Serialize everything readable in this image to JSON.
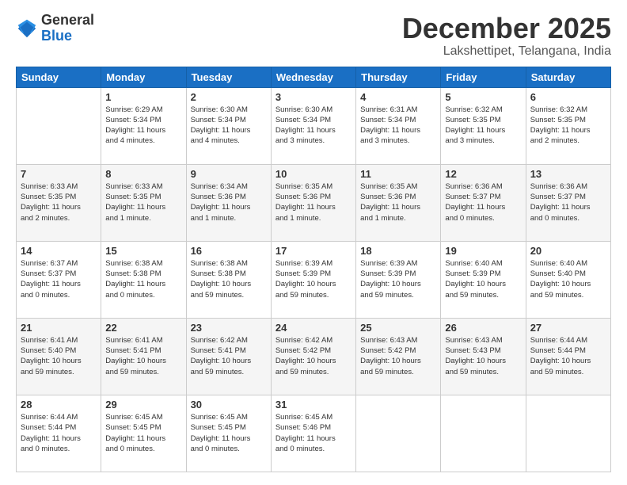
{
  "logo": {
    "general": "General",
    "blue": "Blue"
  },
  "title": "December 2025",
  "location": "Lakshettipet, Telangana, India",
  "weekdays": [
    "Sunday",
    "Monday",
    "Tuesday",
    "Wednesday",
    "Thursday",
    "Friday",
    "Saturday"
  ],
  "weeks": [
    [
      {
        "day": "",
        "info": ""
      },
      {
        "day": "1",
        "info": "Sunrise: 6:29 AM\nSunset: 5:34 PM\nDaylight: 11 hours\nand 4 minutes."
      },
      {
        "day": "2",
        "info": "Sunrise: 6:30 AM\nSunset: 5:34 PM\nDaylight: 11 hours\nand 4 minutes."
      },
      {
        "day": "3",
        "info": "Sunrise: 6:30 AM\nSunset: 5:34 PM\nDaylight: 11 hours\nand 3 minutes."
      },
      {
        "day": "4",
        "info": "Sunrise: 6:31 AM\nSunset: 5:34 PM\nDaylight: 11 hours\nand 3 minutes."
      },
      {
        "day": "5",
        "info": "Sunrise: 6:32 AM\nSunset: 5:35 PM\nDaylight: 11 hours\nand 3 minutes."
      },
      {
        "day": "6",
        "info": "Sunrise: 6:32 AM\nSunset: 5:35 PM\nDaylight: 11 hours\nand 2 minutes."
      }
    ],
    [
      {
        "day": "7",
        "info": "Sunrise: 6:33 AM\nSunset: 5:35 PM\nDaylight: 11 hours\nand 2 minutes."
      },
      {
        "day": "8",
        "info": "Sunrise: 6:33 AM\nSunset: 5:35 PM\nDaylight: 11 hours\nand 1 minute."
      },
      {
        "day": "9",
        "info": "Sunrise: 6:34 AM\nSunset: 5:36 PM\nDaylight: 11 hours\nand 1 minute."
      },
      {
        "day": "10",
        "info": "Sunrise: 6:35 AM\nSunset: 5:36 PM\nDaylight: 11 hours\nand 1 minute."
      },
      {
        "day": "11",
        "info": "Sunrise: 6:35 AM\nSunset: 5:36 PM\nDaylight: 11 hours\nand 1 minute."
      },
      {
        "day": "12",
        "info": "Sunrise: 6:36 AM\nSunset: 5:37 PM\nDaylight: 11 hours\nand 0 minutes."
      },
      {
        "day": "13",
        "info": "Sunrise: 6:36 AM\nSunset: 5:37 PM\nDaylight: 11 hours\nand 0 minutes."
      }
    ],
    [
      {
        "day": "14",
        "info": "Sunrise: 6:37 AM\nSunset: 5:37 PM\nDaylight: 11 hours\nand 0 minutes."
      },
      {
        "day": "15",
        "info": "Sunrise: 6:38 AM\nSunset: 5:38 PM\nDaylight: 11 hours\nand 0 minutes."
      },
      {
        "day": "16",
        "info": "Sunrise: 6:38 AM\nSunset: 5:38 PM\nDaylight: 10 hours\nand 59 minutes."
      },
      {
        "day": "17",
        "info": "Sunrise: 6:39 AM\nSunset: 5:39 PM\nDaylight: 10 hours\nand 59 minutes."
      },
      {
        "day": "18",
        "info": "Sunrise: 6:39 AM\nSunset: 5:39 PM\nDaylight: 10 hours\nand 59 minutes."
      },
      {
        "day": "19",
        "info": "Sunrise: 6:40 AM\nSunset: 5:39 PM\nDaylight: 10 hours\nand 59 minutes."
      },
      {
        "day": "20",
        "info": "Sunrise: 6:40 AM\nSunset: 5:40 PM\nDaylight: 10 hours\nand 59 minutes."
      }
    ],
    [
      {
        "day": "21",
        "info": "Sunrise: 6:41 AM\nSunset: 5:40 PM\nDaylight: 10 hours\nand 59 minutes."
      },
      {
        "day": "22",
        "info": "Sunrise: 6:41 AM\nSunset: 5:41 PM\nDaylight: 10 hours\nand 59 minutes."
      },
      {
        "day": "23",
        "info": "Sunrise: 6:42 AM\nSunset: 5:41 PM\nDaylight: 10 hours\nand 59 minutes."
      },
      {
        "day": "24",
        "info": "Sunrise: 6:42 AM\nSunset: 5:42 PM\nDaylight: 10 hours\nand 59 minutes."
      },
      {
        "day": "25",
        "info": "Sunrise: 6:43 AM\nSunset: 5:42 PM\nDaylight: 10 hours\nand 59 minutes."
      },
      {
        "day": "26",
        "info": "Sunrise: 6:43 AM\nSunset: 5:43 PM\nDaylight: 10 hours\nand 59 minutes."
      },
      {
        "day": "27",
        "info": "Sunrise: 6:44 AM\nSunset: 5:44 PM\nDaylight: 10 hours\nand 59 minutes."
      }
    ],
    [
      {
        "day": "28",
        "info": "Sunrise: 6:44 AM\nSunset: 5:44 PM\nDaylight: 11 hours\nand 0 minutes."
      },
      {
        "day": "29",
        "info": "Sunrise: 6:45 AM\nSunset: 5:45 PM\nDaylight: 11 hours\nand 0 minutes."
      },
      {
        "day": "30",
        "info": "Sunrise: 6:45 AM\nSunset: 5:45 PM\nDaylight: 11 hours\nand 0 minutes."
      },
      {
        "day": "31",
        "info": "Sunrise: 6:45 AM\nSunset: 5:46 PM\nDaylight: 11 hours\nand 0 minutes."
      },
      {
        "day": "",
        "info": ""
      },
      {
        "day": "",
        "info": ""
      },
      {
        "day": "",
        "info": ""
      }
    ]
  ]
}
